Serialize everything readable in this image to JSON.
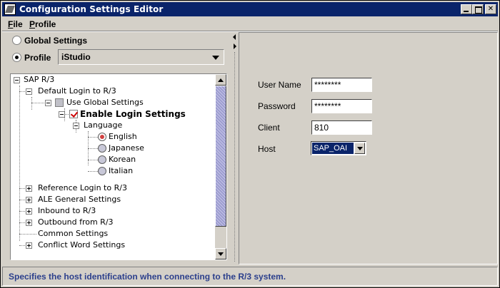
{
  "window": {
    "title": "Configuration Settings Editor",
    "icon": "app-icon"
  },
  "menu": {
    "file_rest": "ile",
    "file_key": "F",
    "profile_key": "P",
    "profile_rest": "rofile"
  },
  "settings_mode": {
    "global_label": "Global Settings",
    "profile_label": "Profile",
    "selected": "Profile",
    "profile_value": "iStudio"
  },
  "tree": {
    "root": "SAP R/3",
    "default_login": "Default Login to R/3",
    "use_global": "Use Global Settings",
    "enable_login": "Enable Login Settings",
    "language": "Language",
    "languages": [
      "English",
      "Japanese",
      "Korean",
      "Italian"
    ],
    "selected_language": "English",
    "reference_login": "Reference Login to R/3",
    "ale_general": "ALE General Settings",
    "inbound": "Inbound to R/3",
    "outbound": "Outbound from R/3",
    "common": "Common Settings",
    "conflict_word": "Conflict Word Settings"
  },
  "login_form": {
    "user_name_label": "User Name",
    "user_name_value": "********",
    "password_label": "Password",
    "password_value": "********",
    "client_label": "Client",
    "client_value": "810",
    "host_label": "Host",
    "host_value": "SAP_OAI"
  },
  "status": {
    "text": "Specifies the host identification when connecting to the R/3 system."
  },
  "colors": {
    "titlebar": "#0a246a",
    "status_text": "#2b3f8c",
    "window_bg": "#d4d0c8"
  }
}
